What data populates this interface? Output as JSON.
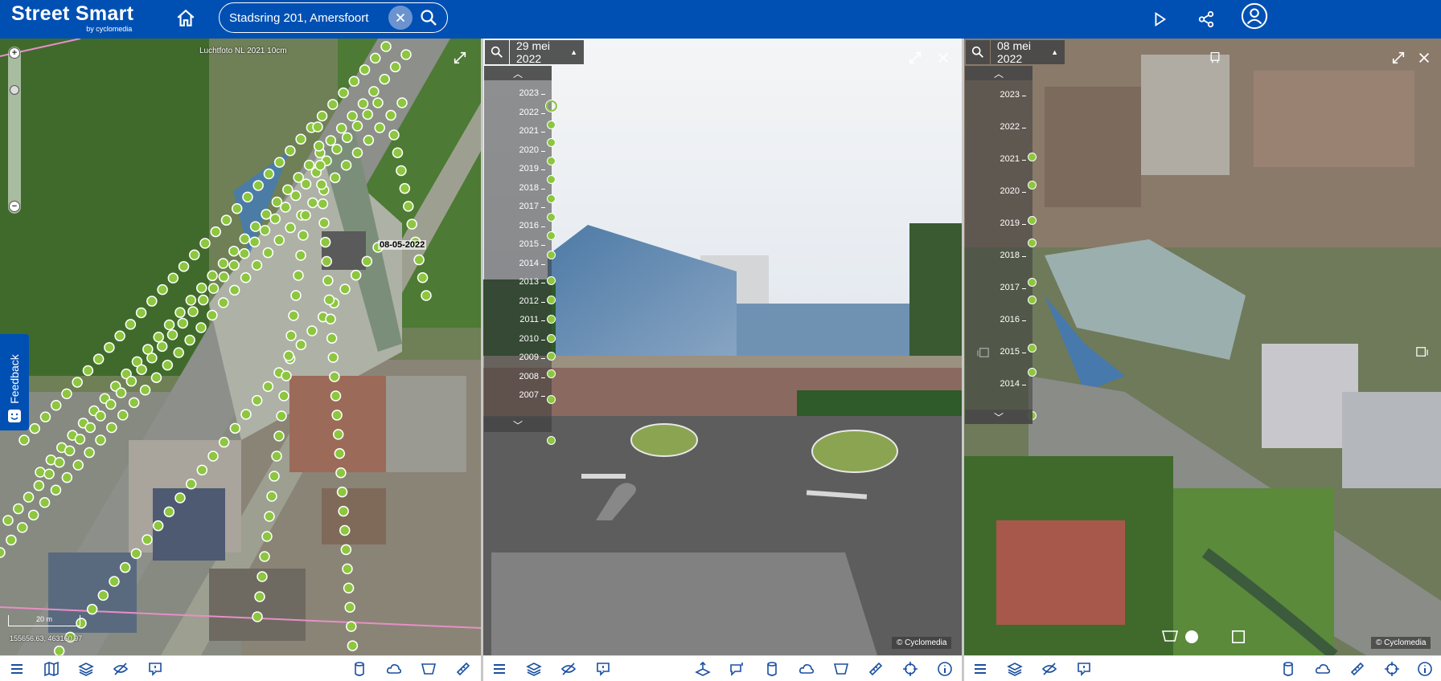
{
  "header": {
    "brand_title": "Street Smart",
    "brand_sub": "by cyclomedia",
    "search_value": "Stadsring 201, Amersfoort",
    "icons": [
      "home-icon",
      "clear-icon",
      "search-icon",
      "play-icon",
      "share-icon",
      "user-icon"
    ]
  },
  "left": {
    "caption": "Luchtfoto NL 2021 10cm",
    "date_label": "08-05-2022",
    "scale": "20 m",
    "coords": "155656.63, 463160.97",
    "zoom_in": "+",
    "zoom_out": "−",
    "feedback": "Feedback",
    "toolbar_icons": [
      "menu-icon",
      "map-icon",
      "layers-icon",
      "visibility-icon",
      "report-icon",
      "cylinder-icon",
      "cloud-icon",
      "area-icon",
      "ruler-icon"
    ]
  },
  "middle": {
    "date": "29 mei 2022",
    "years": [
      "2023",
      "2022",
      "2021",
      "2020",
      "2019",
      "2018",
      "2017",
      "2016",
      "2015",
      "2014",
      "2013",
      "2012",
      "2011",
      "2010",
      "2009",
      "2008",
      "2007"
    ],
    "copyright": "© Cyclomedia",
    "toolbar_icons": [
      "menu-icon",
      "layers-icon",
      "visibility-icon",
      "report-icon",
      "level-icon",
      "annotation-icon",
      "cylinder-icon",
      "cloud-icon",
      "area-icon",
      "ruler-icon",
      "crosshair-icon",
      "info-icon"
    ]
  },
  "right": {
    "date": "08 mei 2022",
    "years": [
      "2023",
      "2022",
      "2021",
      "2020",
      "2019",
      "2018",
      "2017",
      "2016",
      "2015",
      "2014"
    ],
    "copyright": "© Cyclomedia",
    "toolbar_icons": [
      "menu-icon",
      "layers-icon",
      "visibility-icon",
      "report-icon",
      "cylinder-icon",
      "cloud-icon",
      "ruler-icon",
      "crosshair-icon",
      "info-icon"
    ]
  },
  "colors": {
    "brand": "#0050b3",
    "recording_dot": "#8dc63f"
  }
}
